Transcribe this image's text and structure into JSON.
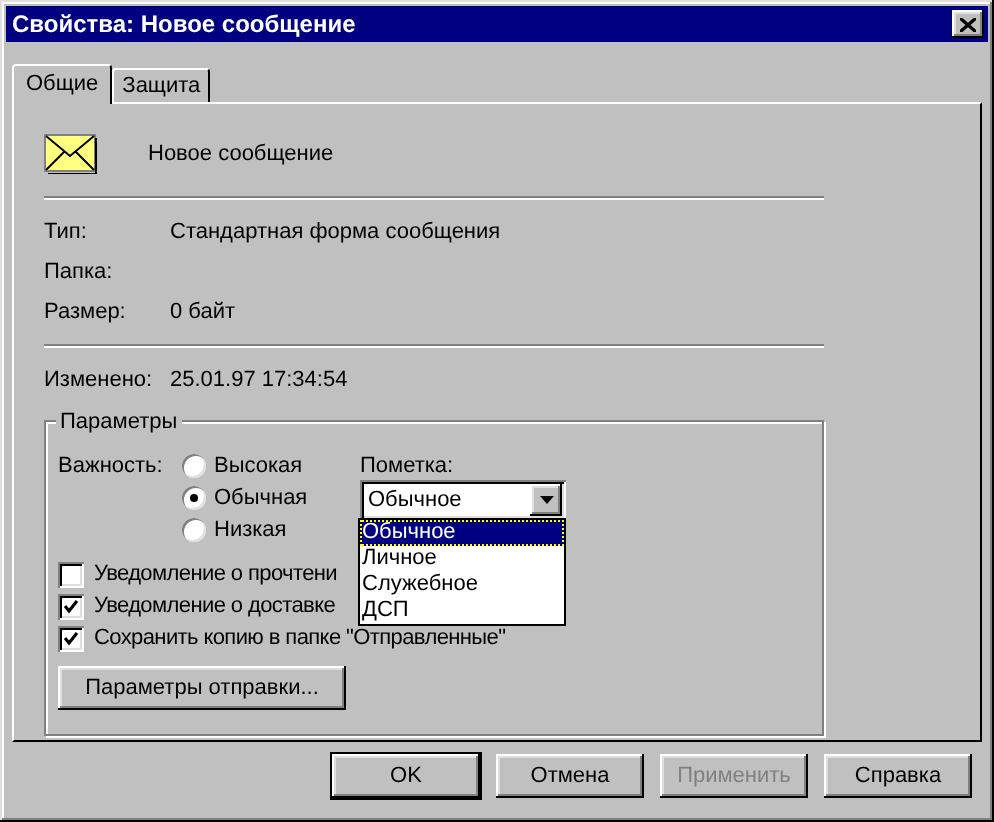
{
  "window": {
    "title": "Свойства: Новое сообщение"
  },
  "tabs": [
    {
      "label": "Общие",
      "selected": true
    },
    {
      "label": "Защита",
      "selected": false
    }
  ],
  "message": {
    "subject": "Новое сообщение"
  },
  "details": [
    {
      "label": "Тип:",
      "value": "Стандартная форма сообщения"
    },
    {
      "label": "Папка:"
    },
    {
      "label": "Размер:",
      "value": "0 байт"
    }
  ],
  "modified": {
    "label": "Изменено:",
    "value": "25.01.97 17:34:54"
  },
  "parameters": {
    "title": "Параметры",
    "importance": {
      "label": "Важность:",
      "options": [
        {
          "label": "Высокая",
          "selected": false
        },
        {
          "label": "Обычная",
          "selected": true
        },
        {
          "label": "Низкая",
          "selected": false
        }
      ]
    },
    "flag": {
      "label": "Пометка:",
      "value": "Обычное",
      "expanded": true,
      "options": [
        {
          "label": "Обычное",
          "selected": true
        },
        {
          "label": "Личное",
          "selected": false
        },
        {
          "label": "Служебное",
          "selected": false
        },
        {
          "label": "ДСП",
          "selected": false
        }
      ]
    },
    "checkboxes": [
      {
        "label": "Уведомление о прочтени",
        "checked": false
      },
      {
        "label": "Уведомление о доставке",
        "checked": true
      },
      {
        "label": "Сохранить копию в папке \"Отправленные\"",
        "checked": true
      }
    ],
    "send_options_button": "Параметры отправки..."
  },
  "buttons": [
    {
      "label": "OK",
      "disabled": false,
      "default": true
    },
    {
      "label": "Отмена",
      "disabled": false,
      "default": false
    },
    {
      "label": "Применить",
      "disabled": true,
      "default": false
    },
    {
      "label": "Справка",
      "disabled": false,
      "default": false
    }
  ]
}
